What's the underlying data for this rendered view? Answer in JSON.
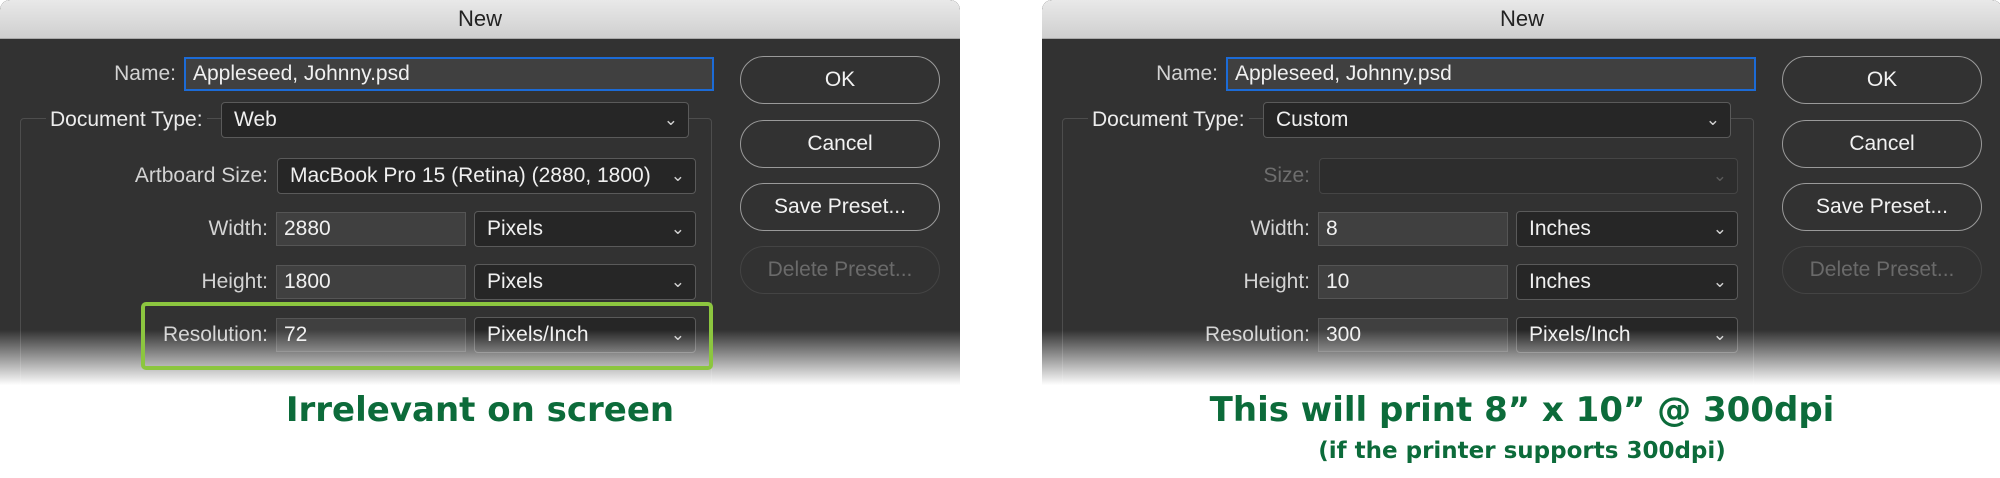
{
  "left_dialog": {
    "title": "New",
    "name_label": "Name:",
    "name_value": "Appleseed, Johnny.psd",
    "doc_type_label": "Document Type:",
    "doc_type_value": "Web",
    "size_label": "Artboard Size:",
    "size_value": "MacBook Pro 15 (Retina) (2880, 1800)",
    "width_label": "Width:",
    "width_value": "2880",
    "width_unit": "Pixels",
    "height_label": "Height:",
    "height_value": "1800",
    "height_unit": "Pixels",
    "resolution_label": "Resolution:",
    "resolution_value": "72",
    "resolution_unit": "Pixels/Inch",
    "buttons": {
      "ok": "OK",
      "cancel": "Cancel",
      "save_preset": "Save Preset...",
      "delete_preset": "Delete Preset..."
    }
  },
  "left_caption": "Irrelevant on screen",
  "right_dialog": {
    "title": "New",
    "name_label": "Name:",
    "name_value": "Appleseed, Johnny.psd",
    "doc_type_label": "Document Type:",
    "doc_type_value": "Custom",
    "size_label": "Size:",
    "size_value": "",
    "width_label": "Width:",
    "width_value": "8",
    "width_unit": "Inches",
    "height_label": "Height:",
    "height_value": "10",
    "height_unit": "Inches",
    "resolution_label": "Resolution:",
    "resolution_value": "300",
    "resolution_unit": "Pixels/Inch",
    "buttons": {
      "ok": "OK",
      "cancel": "Cancel",
      "save_preset": "Save Preset...",
      "delete_preset": "Delete Preset..."
    }
  },
  "right_caption": "This will print 8” x 10” @ 300dpi",
  "right_subcaption": "(if the printer supports 300dpi)",
  "colors": {
    "dialog_bg": "#323232",
    "highlight": "#8cc63f",
    "caption": "#0c6b3a",
    "focus_ring": "#1c6bd6"
  },
  "icons": {
    "dropdown": "chevron-down-icon"
  }
}
